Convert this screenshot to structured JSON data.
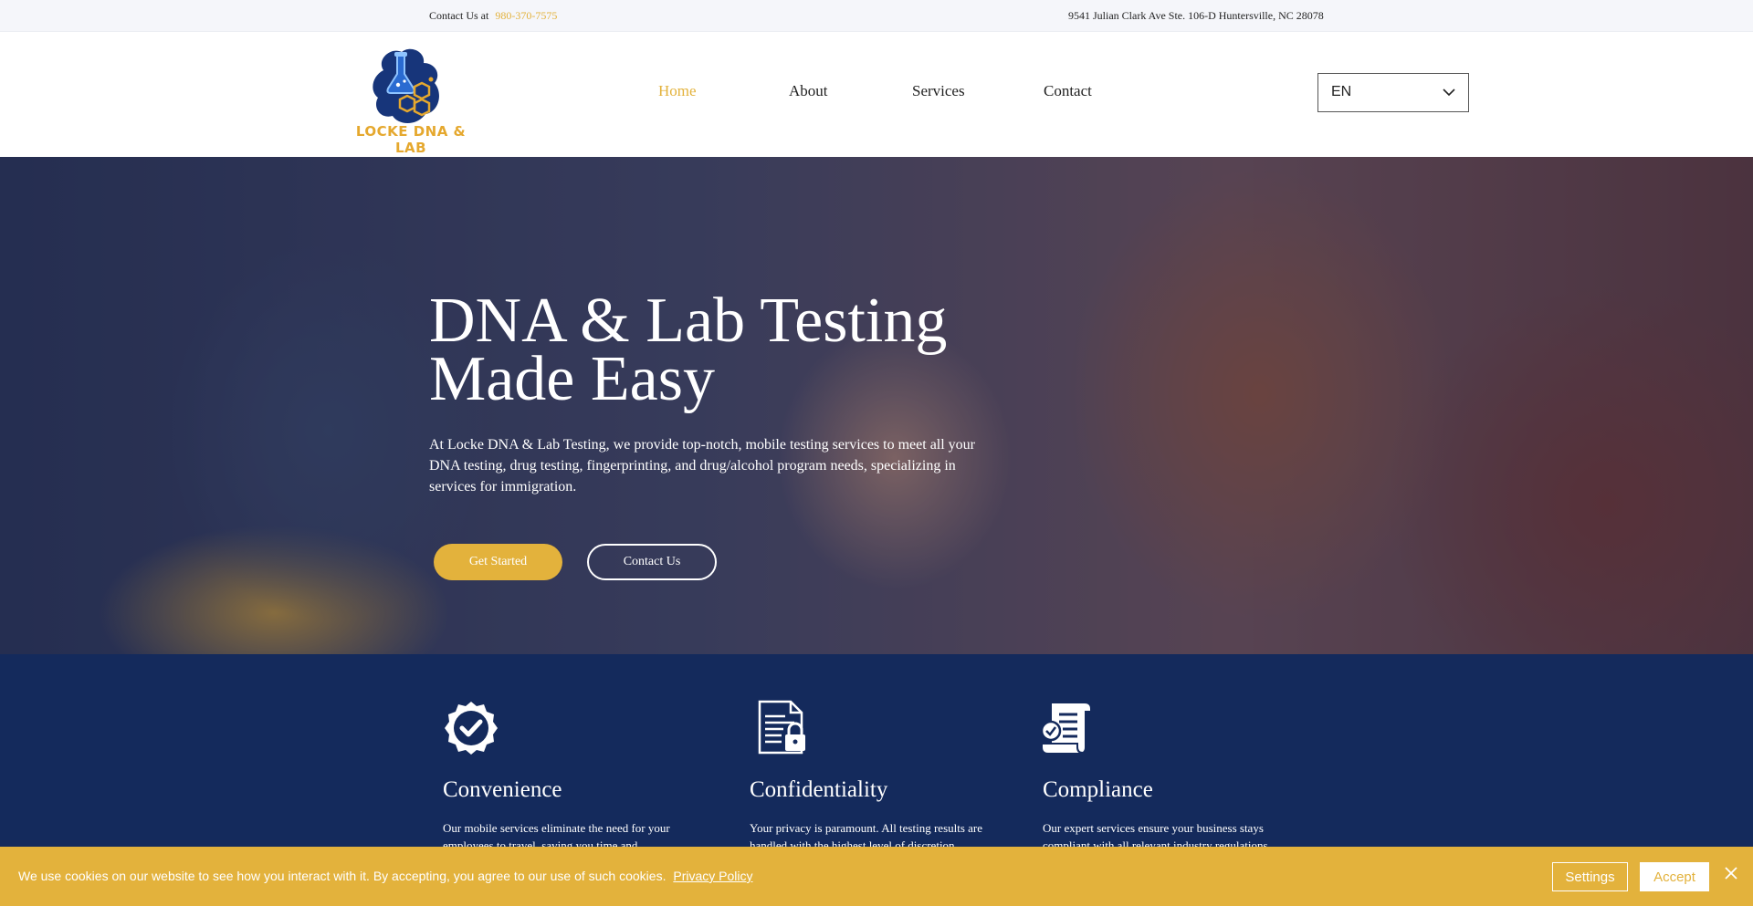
{
  "topbar": {
    "contact_label": "Contact Us at",
    "phone": "980-370-7575",
    "address": "9541 Julian Clark Ave Ste. 106-D Huntersville, NC 28078"
  },
  "brand": {
    "logo_text": "LOCKE DNA & LAB"
  },
  "nav": {
    "items": [
      {
        "label": "Home",
        "active": true
      },
      {
        "label": "About"
      },
      {
        "label": "Services"
      },
      {
        "label": "Contact"
      }
    ]
  },
  "language": {
    "value": "EN"
  },
  "hero": {
    "title_line1": "DNA & Lab Testing",
    "title_line2": "Made Easy",
    "description": "At Locke DNA & Lab Testing, we provide top-notch, mobile testing services to meet all your DNA testing, drug testing, fingerprinting, and drug/alcohol program needs, specializing in services for immigration.",
    "primary_button": "Get Started",
    "secondary_button": "Contact Us"
  },
  "features": [
    {
      "icon": "check-badge-icon",
      "title": "Convenience",
      "text": "Our mobile services eliminate the need for your employees to travel, saving you time and"
    },
    {
      "icon": "locked-document-icon",
      "title": "Confidentiality",
      "text": "Your privacy is paramount. All testing results are handled with the highest level of discretion."
    },
    {
      "icon": "certificate-scroll-icon",
      "title": "Compliance",
      "text": "Our expert services ensure your business stays compliant with all relevant industry regulations."
    }
  ],
  "cookie": {
    "message": "We use cookies on our website to see how you interact with it. By accepting, you agree to our use of such cookies.",
    "policy_link": "Privacy Policy",
    "settings_label": "Settings",
    "accept_label": "Accept"
  },
  "colors": {
    "accent": "#e3b23c",
    "navy": "#142a5c"
  }
}
